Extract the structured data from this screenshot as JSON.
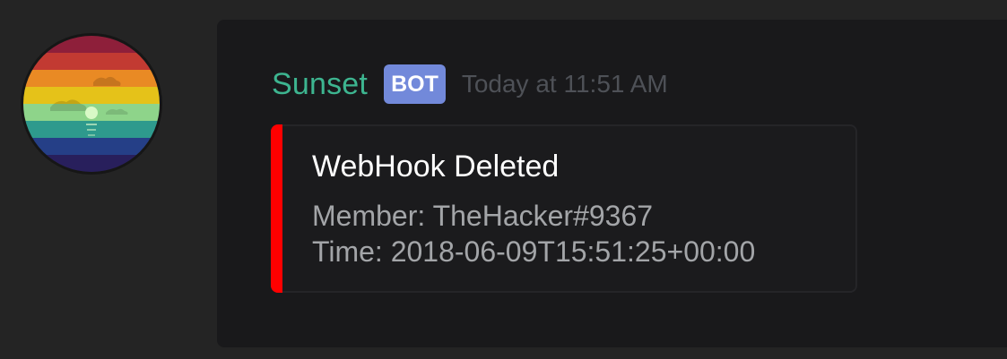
{
  "message": {
    "username": "Sunset",
    "bot_tag": "BOT",
    "timestamp": "Today at 11:51 AM",
    "username_color": "#3db590",
    "bot_tag_color": "#7289da"
  },
  "embed": {
    "accent_color": "#ff0000",
    "title": "WebHook Deleted",
    "lines": [
      "Member: TheHacker#9367",
      "Time: 2018-06-09T15:51:25+00:00"
    ]
  },
  "avatar": {
    "icon": "sunset-avatar-icon"
  }
}
